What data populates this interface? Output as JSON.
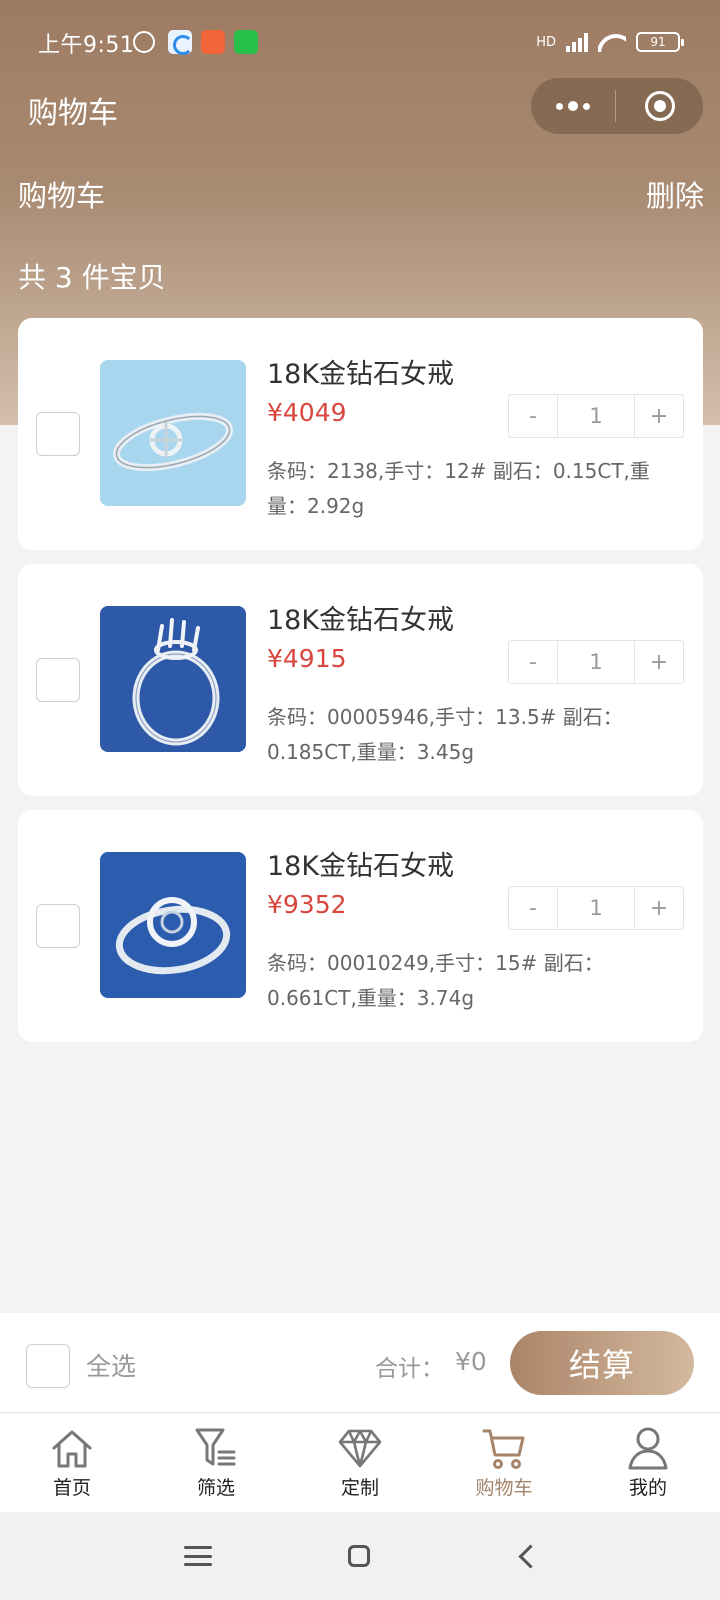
{
  "status_bar": {
    "time": "上午9:51",
    "battery": "91",
    "network": "HD",
    "icons": [
      "alarm-icon",
      "app-icon",
      "app-icon",
      "wechat-icon",
      "signal-icon",
      "wifi-icon",
      "battery-icon"
    ]
  },
  "nav": {
    "title": "购物车",
    "more_icon": "more-dots-icon",
    "target_icon": "target-icon"
  },
  "header": {
    "subtitle": "购物车",
    "delete_label": "删除",
    "count_text": "共 3 件宝贝"
  },
  "cart_items": [
    {
      "name": "18K金钻石女戒",
      "price": "¥4049",
      "quantity": "1",
      "minus": "-",
      "plus": "+",
      "description": "条码：2138,手寸：12# 副石：0.15CT,重量：2.92g",
      "image_bg": "#a7d6ee"
    },
    {
      "name": "18K金钻石女戒",
      "price": "¥4915",
      "quantity": "1",
      "minus": "-",
      "plus": "+",
      "description": "条码：00005946,手寸：13.5# 副石：0.185CT,重量：3.45g",
      "image_bg": "#2e59a8"
    },
    {
      "name": "18K金钻石女戒",
      "price": "¥9352",
      "quantity": "1",
      "minus": "-",
      "plus": "+",
      "description": "条码：00010249,手寸：15# 副石：0.661CT,重量：3.74g",
      "image_bg": "#2b5cad"
    }
  ],
  "checkout": {
    "select_all_label": "全选",
    "total_label": "合计：",
    "total_value": "¥0",
    "checkout_label": "结算"
  },
  "tabbar": [
    {
      "label": "首页",
      "icon": "home-icon",
      "active": false
    },
    {
      "label": "筛选",
      "icon": "filter-icon",
      "active": false
    },
    {
      "label": "定制",
      "icon": "diamond-icon",
      "active": false
    },
    {
      "label": "购物车",
      "icon": "cart-icon",
      "active": true
    },
    {
      "label": "我的",
      "icon": "user-icon",
      "active": false
    }
  ],
  "colors": {
    "header_brown": "#a68a72",
    "accent_brown": "#a5846a",
    "price_red": "#d9463e"
  }
}
